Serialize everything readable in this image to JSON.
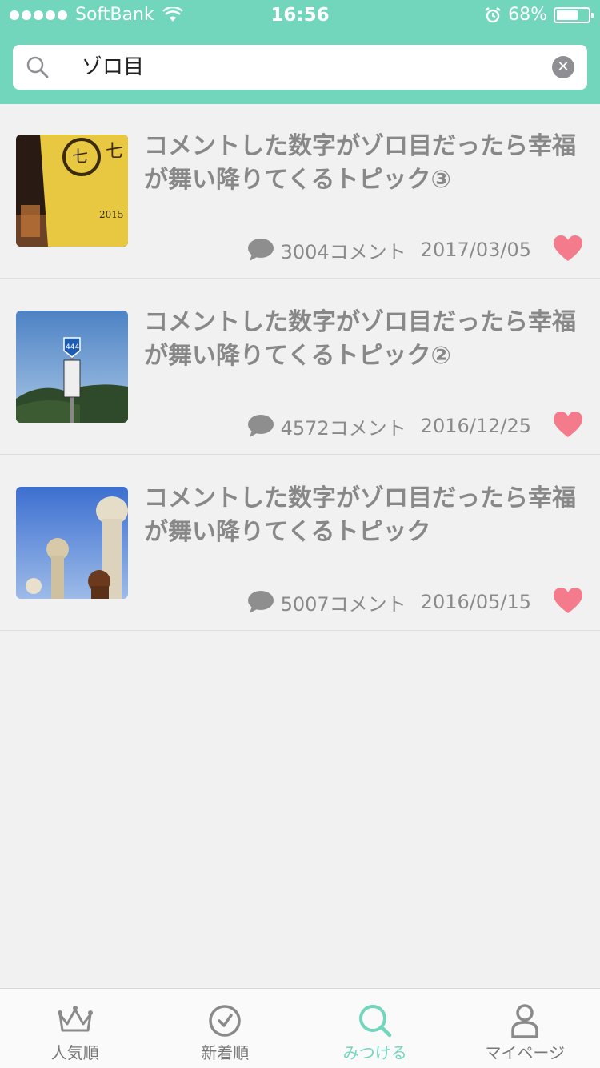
{
  "status_bar": {
    "carrier": "SoftBank",
    "time": "16:56",
    "battery_percent": "68%",
    "battery_level": 0.68
  },
  "search": {
    "query": "ゾロ目",
    "clear_label": "✕"
  },
  "results": [
    {
      "title": "コメントした数字がゾロ目だったら幸福が舞い降りてくるトピック③",
      "comments": "3004コメント",
      "date": "2017/03/05",
      "thumb": "sake-bottle"
    },
    {
      "title": "コメントした数字がゾロ目だったら幸福が舞い降りてくるトピック②",
      "comments": "4572コメント",
      "date": "2016/12/25",
      "thumb": "route-444-sign"
    },
    {
      "title": "コメントした数字がゾロ目だったら幸福が舞い降りてくるトピック",
      "comments": "5007コメント",
      "date": "2016/05/15",
      "thumb": "alpacas"
    }
  ],
  "tabs": [
    {
      "label": "人気順",
      "icon": "crown-icon",
      "active": false
    },
    {
      "label": "新着順",
      "icon": "clock-icon",
      "active": false
    },
    {
      "label": "みつける",
      "icon": "search-icon",
      "active": true
    },
    {
      "label": "マイページ",
      "icon": "person-icon",
      "active": false
    }
  ],
  "colors": {
    "accent": "#72d6bd",
    "heart": "#f47b8c",
    "text_gray": "#888888",
    "background": "#f1f1f1"
  }
}
